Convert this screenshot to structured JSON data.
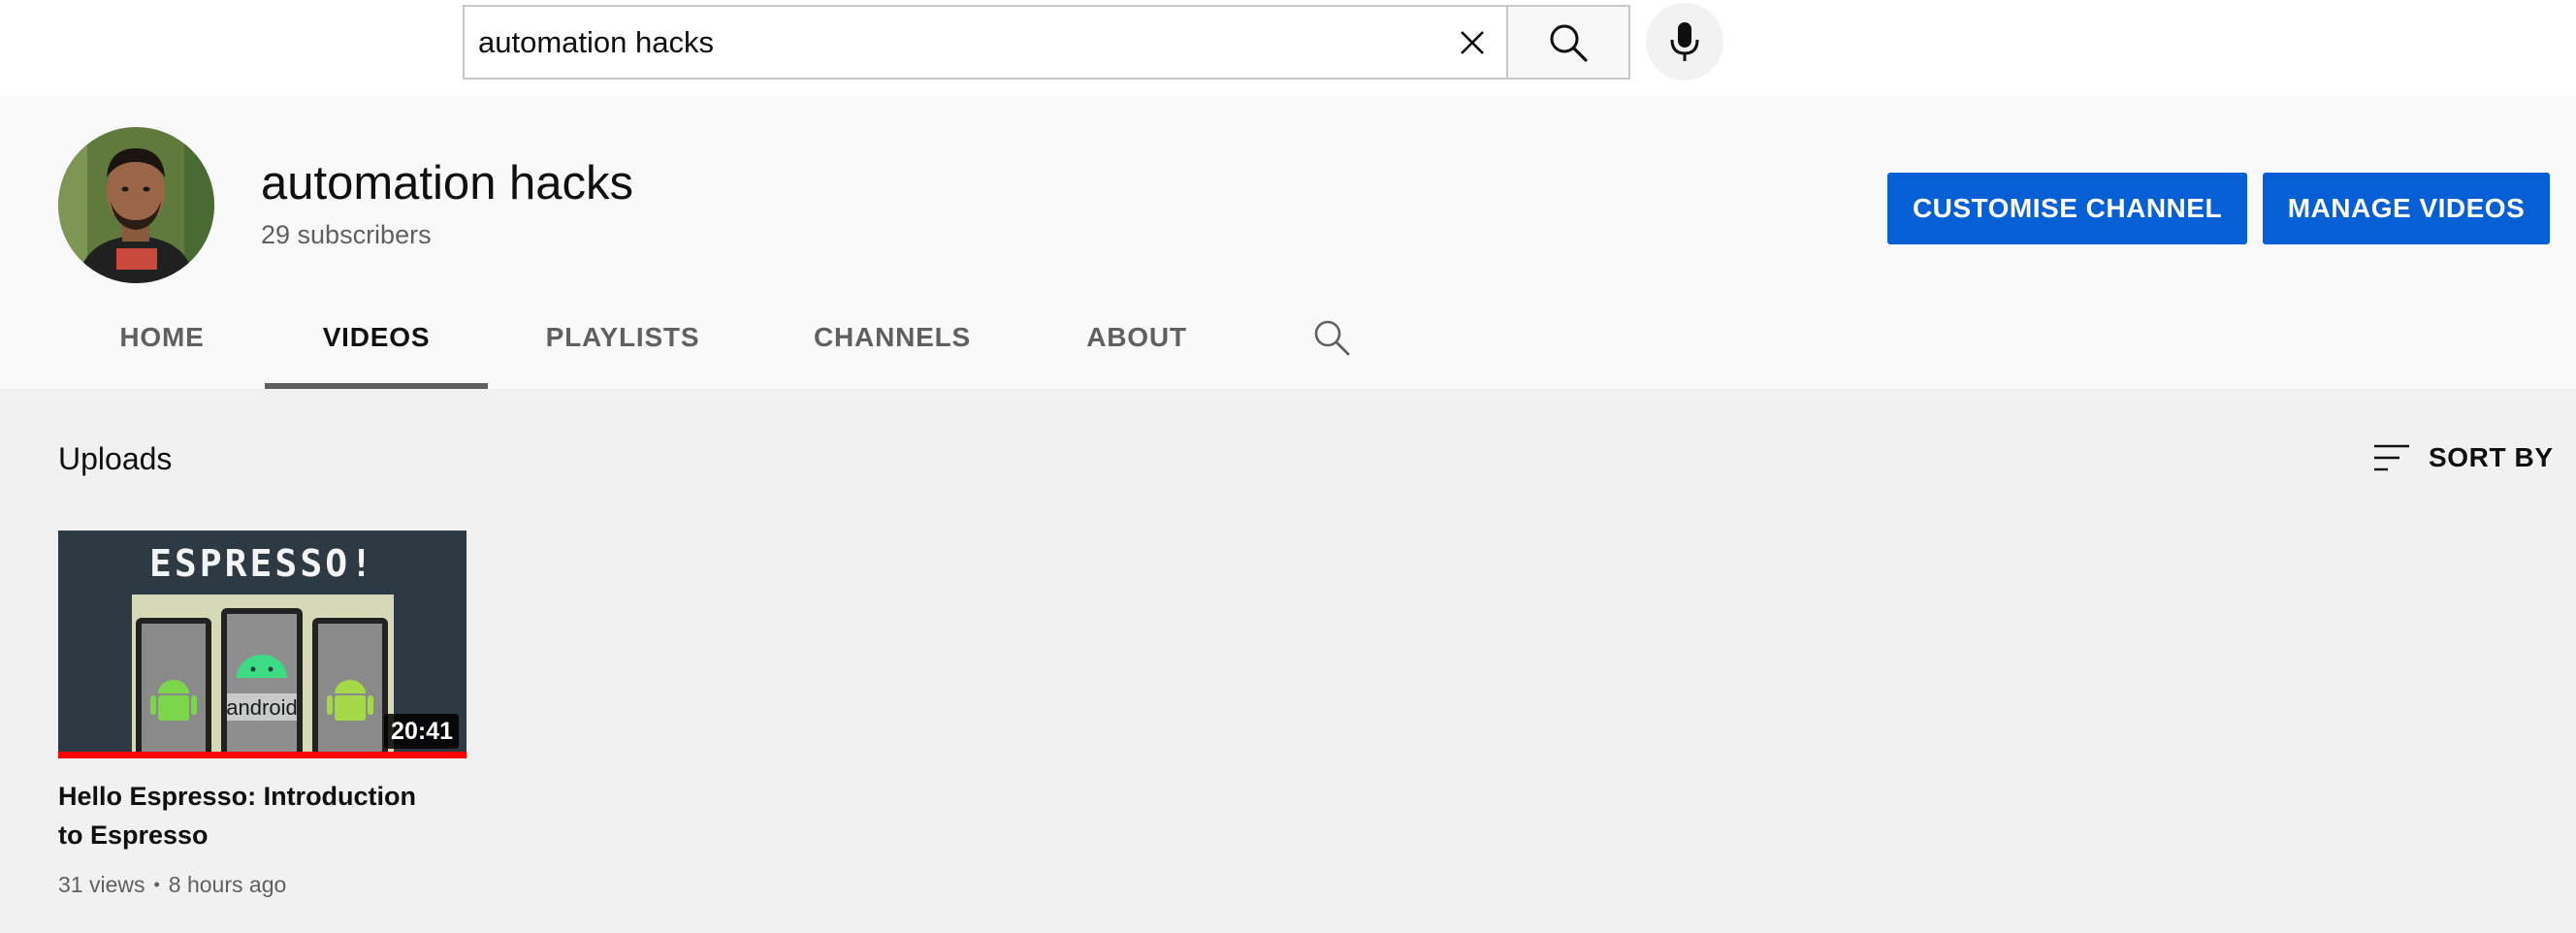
{
  "search": {
    "value": "automation hacks",
    "clear_icon": "close-icon",
    "search_icon": "search-icon",
    "mic_icon": "mic-icon"
  },
  "channel": {
    "name": "automation hacks",
    "subscribers": "29 subscribers",
    "customise_label": "CUSTOMISE CHANNEL",
    "manage_label": "MANAGE VIDEOS",
    "accent_color": "#065fd4"
  },
  "tabs": [
    {
      "label": "HOME",
      "active": false
    },
    {
      "label": "VIDEOS",
      "active": true
    },
    {
      "label": "PLAYLISTS",
      "active": false
    },
    {
      "label": "CHANNELS",
      "active": false
    },
    {
      "label": "ABOUT",
      "active": false
    }
  ],
  "uploads": {
    "title": "Uploads",
    "sort_label": "SORT BY",
    "sort_icon": "sort-icon"
  },
  "videos": [
    {
      "thumbnail_text": "ESPRESSO!",
      "thumbnail_caption": "android",
      "duration": "20:41",
      "watched_fraction": 1.0,
      "title": "Hello Espresso: Introduction to Espresso",
      "views": "31 views",
      "separator": "•",
      "age": "8 hours ago"
    }
  ]
}
